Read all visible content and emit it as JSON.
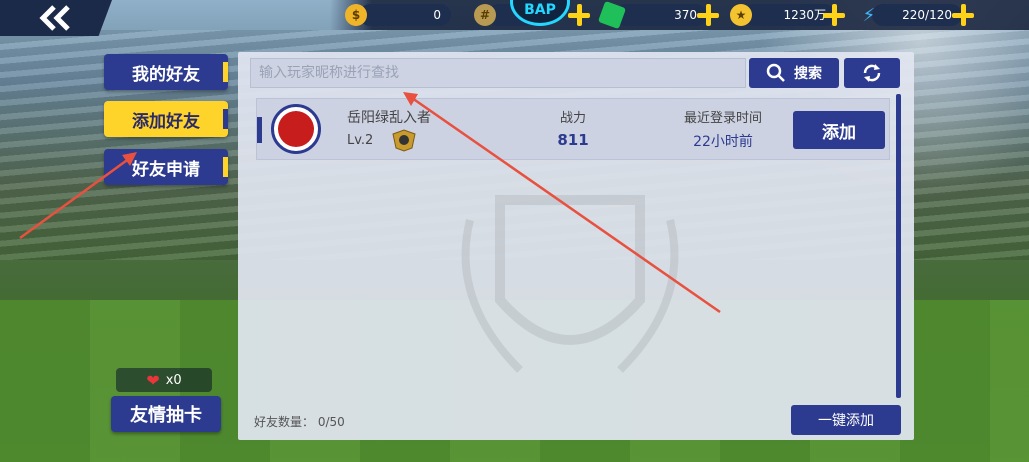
{
  "topbar": {
    "resources": [
      {
        "icon": "gold-coin-icon",
        "value": "0"
      },
      {
        "icon": "token-icon",
        "value": "0"
      },
      {
        "icon": "green-gem-icon",
        "value": "370"
      },
      {
        "icon": "star-coin-icon",
        "value": "1230万"
      },
      {
        "icon": "lightning-icon",
        "value": "220/120"
      }
    ]
  },
  "tabs": {
    "my_friends": "我的好友",
    "add_friend": "添加好友",
    "friend_requests": "好友申请"
  },
  "left_bottom": {
    "hearts": "x0",
    "draw_label": "友情抽卡"
  },
  "search": {
    "placeholder": "输入玩家昵称进行查找",
    "button_label": "搜索"
  },
  "results": [
    {
      "name": "岳阳绿乱入者",
      "level": "Lv.2",
      "power_label": "战力",
      "power_value": "811",
      "last_login_label": "最近登录时间",
      "last_login_value": "22小时前",
      "add_label": "添加"
    }
  ],
  "footer": {
    "friend_count": "好友数量： 0/50",
    "one_click_add": "一键添加"
  },
  "colors": {
    "primary": "#2c3a8f",
    "accent_yellow": "#ffd42a",
    "annotation_red": "#e8503f"
  }
}
